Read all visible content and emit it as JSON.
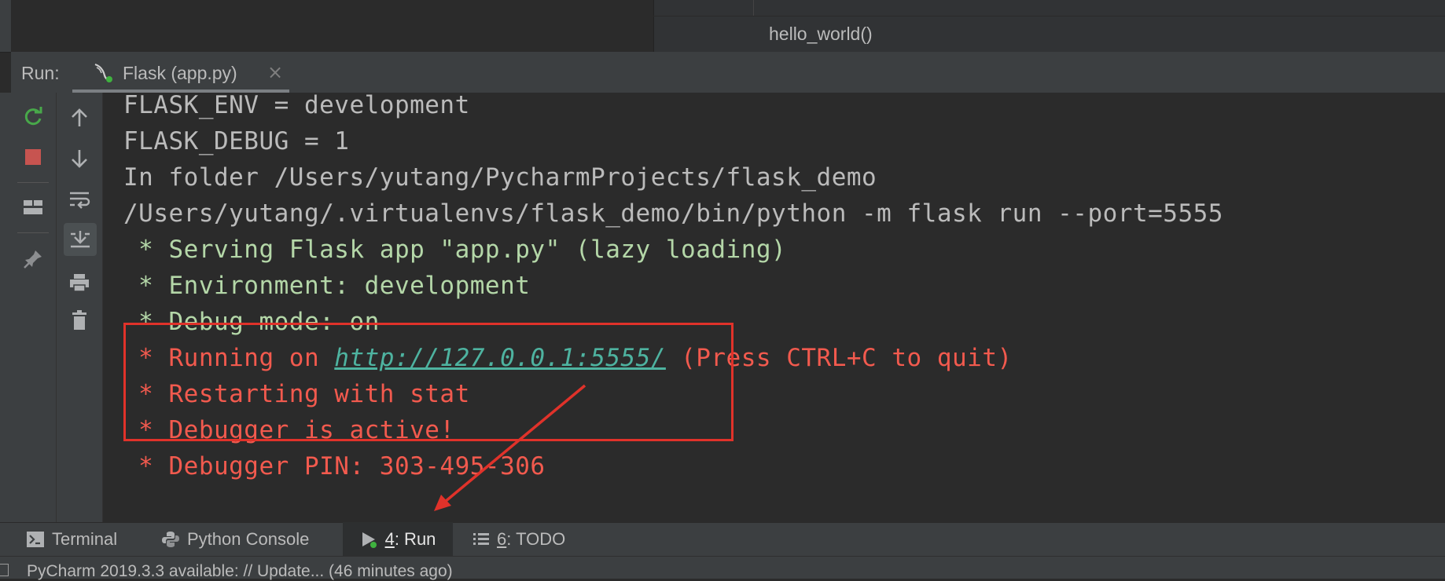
{
  "editor": {
    "breadcrumb": "hello_world()"
  },
  "run_panel": {
    "label": "Run:",
    "tab_title": "Flask (app.py)",
    "tab_close": "×"
  },
  "console": {
    "lines": [
      {
        "text": "FLASK_ENV = development",
        "style": "gray"
      },
      {
        "text": "FLASK_DEBUG = 1",
        "style": "gray"
      },
      {
        "text": "In folder /Users/yutang/PycharmProjects/flask_demo",
        "style": "gray"
      },
      {
        "text": "/Users/yutang/.virtualenvs/flask_demo/bin/python -m flask run --port=5555",
        "style": "gray"
      },
      {
        "text": " * Serving Flask app \"app.py\" (lazy loading)",
        "style": "green"
      },
      {
        "text": " * Environment: development",
        "style": "green"
      },
      {
        "text": " * Debug mode: on",
        "style": "green"
      },
      {
        "text_prefix": " * Running on ",
        "link": "http://127.0.0.1:5555/",
        "text_suffix": " (Press CTRL+C to quit)",
        "style": "red"
      },
      {
        "text": " * Restarting with stat",
        "style": "red"
      },
      {
        "text": " * Debugger is active!",
        "style": "red"
      },
      {
        "text": " * Debugger PIN: 303-495-306",
        "style": "red"
      }
    ]
  },
  "tool_windows": {
    "terminal": "Terminal",
    "python_console": "Python Console",
    "run_number": "4",
    "run_label": ": Run",
    "todo_number": "6",
    "todo_label": ": TODO"
  },
  "status_bar": {
    "text": "PyCharm 2019.3.3 available: // Update... (46 minutes ago)"
  },
  "colors": {
    "background": "#2b2b2b",
    "panel": "#3c3f41",
    "console_gray": "#bbbbbb",
    "console_green": "#b4d7a8",
    "console_red": "#f25a4e",
    "link": "#4eb3a0",
    "annotation": "#e0322a"
  }
}
